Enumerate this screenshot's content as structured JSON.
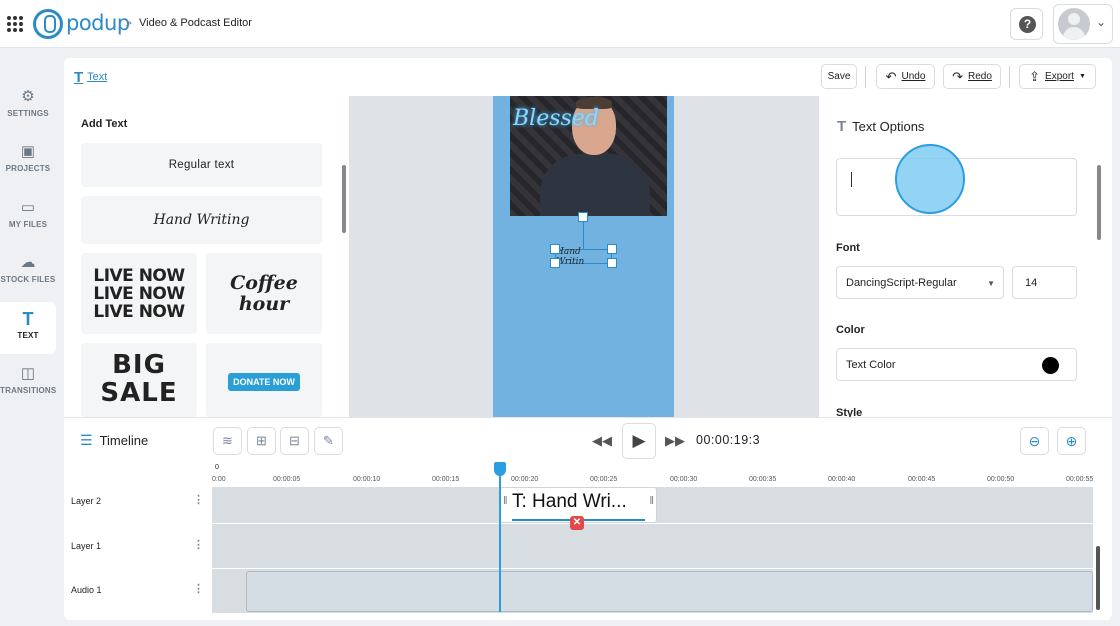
{
  "topbar": {
    "logo_text": "podup",
    "breadcrumb_separator": ">",
    "breadcrumb": "Video & Podcast Editor",
    "help_glyph": "?"
  },
  "sidebar": {
    "items": [
      {
        "label": "SETTINGS",
        "icon": "gear-icon"
      },
      {
        "label": "PROJECTS",
        "icon": "projects-icon"
      },
      {
        "label": "MY FILES",
        "icon": "folder-icon"
      },
      {
        "label": "STOCK FILES",
        "icon": "cloud-icon"
      },
      {
        "label": "TEXT",
        "icon": "text-icon",
        "active": true
      },
      {
        "label": "TRANSITIONS",
        "icon": "transitions-icon"
      }
    ]
  },
  "toolbar": {
    "tab_label": "Text",
    "save_label": "Save",
    "undo_label": "Undo",
    "redo_label": "Redo",
    "export_label": "Export"
  },
  "text_panel": {
    "title": "Add Text",
    "presets": {
      "regular": "Regular text",
      "hand": "Hand Writing",
      "live": "LIVE NOW\nLIVE NOW\nLIVE NOW",
      "coffee": "Coffee\nhour",
      "big": "BIG\nSALE",
      "donate": "DONATE NOW"
    }
  },
  "canvas": {
    "neon_text": "Blessed",
    "selected_text": "Hand Writin"
  },
  "options": {
    "title": "Text Options",
    "text_value": "",
    "font_label": "Font",
    "font_value": "DancingScript-Regular",
    "font_size": "14",
    "color_label": "Color",
    "color_value": "Text Color",
    "color_swatch": "#000000",
    "style_label": "Style"
  },
  "timeline": {
    "title": "Timeline",
    "timecode": "00:00:19:3",
    "ruler_zero": "0",
    "ticks": [
      "0:00",
      "00:00:05",
      "00:00:10",
      "00:00:15",
      "00:00:20",
      "00:00:25",
      "00:00:30",
      "00:00:35",
      "00:00:40",
      "00:00:45",
      "00:00:50",
      "00:00:55"
    ],
    "tracks": [
      {
        "name": "Layer 2"
      },
      {
        "name": "Layer 1"
      },
      {
        "name": "Audio 1"
      }
    ],
    "text_clip_label": "T: Hand Wri..."
  },
  "colors": {
    "accent": "#2b8bc6",
    "playhead": "#2b9ee0",
    "delete": "#e24b4b"
  }
}
